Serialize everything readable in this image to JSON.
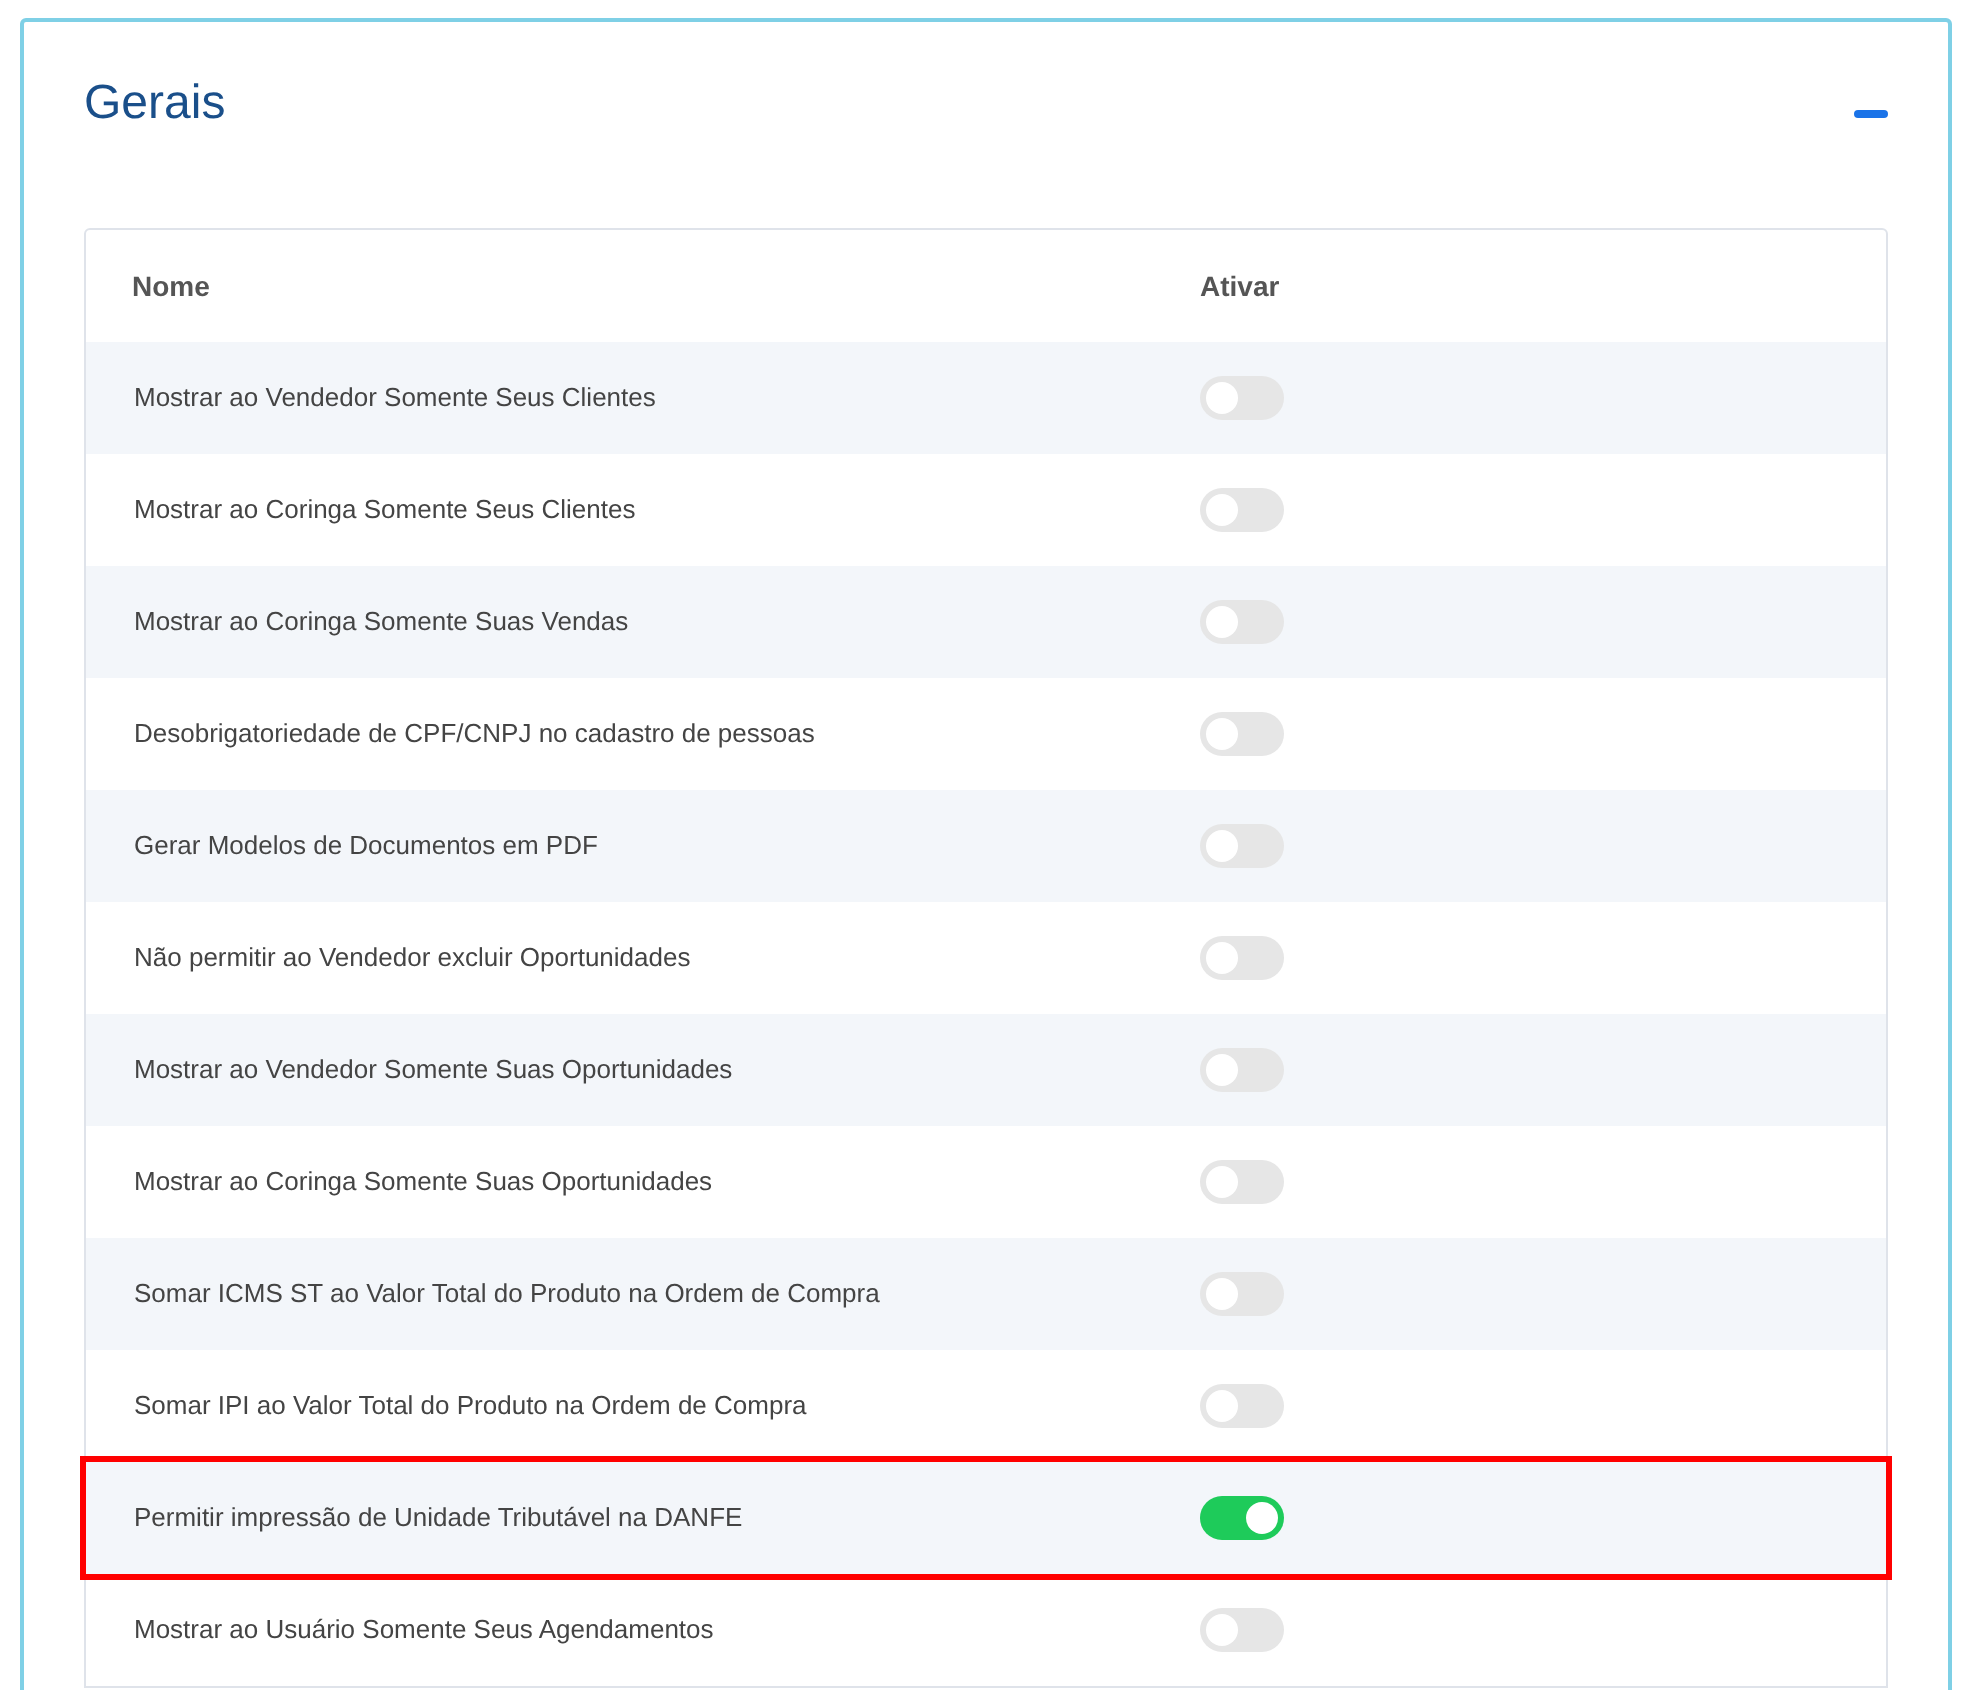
{
  "section": {
    "title": "Gerais",
    "expanded": true
  },
  "table": {
    "columns": [
      "Nome",
      "Ativar"
    ],
    "rows": [
      {
        "name": "Mostrar ao Vendedor Somente Seus Clientes",
        "on": false,
        "highlighted": false
      },
      {
        "name": "Mostrar ao Coringa Somente Seus Clientes",
        "on": false,
        "highlighted": false
      },
      {
        "name": "Mostrar ao Coringa Somente Suas Vendas",
        "on": false,
        "highlighted": false
      },
      {
        "name": "Desobrigatoriedade de CPF/CNPJ no cadastro de pessoas",
        "on": false,
        "highlighted": false
      },
      {
        "name": "Gerar Modelos de Documentos em PDF",
        "on": false,
        "highlighted": false
      },
      {
        "name": "Não permitir ao Vendedor excluir Oportunidades",
        "on": false,
        "highlighted": false
      },
      {
        "name": "Mostrar ao Vendedor Somente Suas Oportunidades",
        "on": false,
        "highlighted": false
      },
      {
        "name": "Mostrar ao Coringa Somente Suas Oportunidades",
        "on": false,
        "highlighted": false
      },
      {
        "name": "Somar ICMS ST ao Valor Total do Produto na Ordem de Compra",
        "on": false,
        "highlighted": false
      },
      {
        "name": "Somar IPI ao Valor Total do Produto na Ordem de Compra",
        "on": false,
        "highlighted": false
      },
      {
        "name": "Permitir impressão de Unidade Tributável na DANFE",
        "on": true,
        "highlighted": true
      },
      {
        "name": "Mostrar ao Usuário Somente Seus Agendamentos",
        "on": false,
        "highlighted": false
      }
    ]
  }
}
